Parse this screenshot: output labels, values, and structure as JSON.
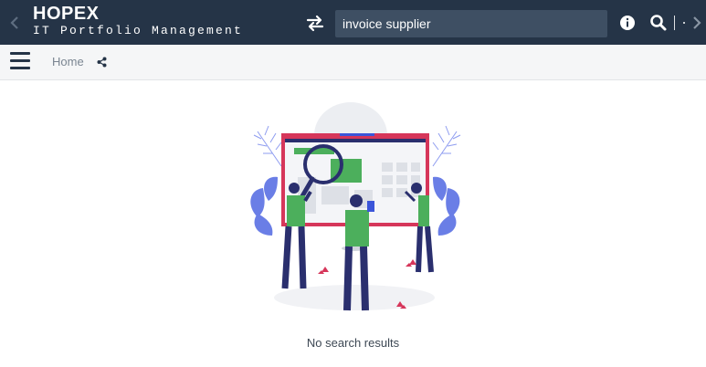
{
  "app": {
    "name": "HOPEX",
    "subtitle": "IT Portfolio Management"
  },
  "header": {
    "search_value": "invoice supplier",
    "icons": [
      "chevron-left-icon",
      "swap-arrows-icon",
      "info-icon",
      "search-icon",
      "chevron-right-icon"
    ]
  },
  "breadcrumb": {
    "home_label": "Home"
  },
  "results": {
    "empty_message": "No search results"
  },
  "colors": {
    "header_bg": "#253447",
    "search_bg": "#3e4f63",
    "subbar_bg": "#f5f6f7",
    "accent_red": "#d6365a",
    "accent_blue": "#3b55d9",
    "accent_green": "#4caf5c"
  }
}
